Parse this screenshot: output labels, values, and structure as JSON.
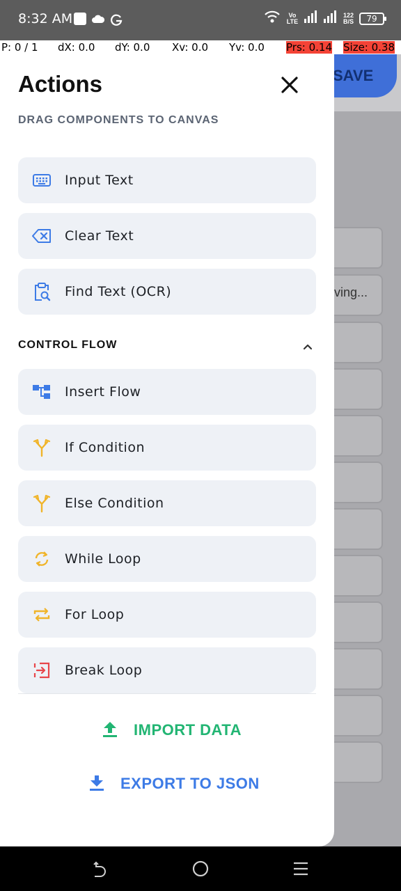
{
  "status_bar": {
    "time": "8:32 AM",
    "network_label": "Vo LTE",
    "speed_value": "122",
    "speed_unit": "B/S",
    "battery": "79"
  },
  "pointer_location": {
    "p": "P: 0 / 1",
    "dx": "dX: 0.0",
    "dy": "dY: 0.0",
    "xv": "Xv: 0.0",
    "yv": "Yv: 0.0",
    "prs": "Prs: 0.14",
    "size": "Size: 0.38"
  },
  "background_app": {
    "save_label": "SAVE",
    "partial_text": "ving..."
  },
  "drawer": {
    "title": "Actions",
    "subtitle": "DRAG COMPONENTS TO CANVAS",
    "text_items": [
      {
        "label": "Input Text",
        "icon": "keyboard-icon"
      },
      {
        "label": "Clear Text",
        "icon": "backspace-icon"
      },
      {
        "label": "Find Text (OCR)",
        "icon": "clipboard-search-icon"
      }
    ],
    "control_flow": {
      "header": "CONTROL FLOW",
      "expanded": true,
      "items": [
        {
          "label": "Insert Flow",
          "icon": "flow-tree-icon"
        },
        {
          "label": "If Condition",
          "icon": "fork-icon"
        },
        {
          "label": "Else Condition",
          "icon": "fork-icon"
        },
        {
          "label": "While Loop",
          "icon": "sync-icon"
        },
        {
          "label": "For Loop",
          "icon": "repeat-icon"
        },
        {
          "label": "Break Loop",
          "icon": "exit-icon"
        }
      ]
    },
    "import_label": "IMPORT DATA",
    "export_label": "EXPORT TO JSON"
  },
  "colors": {
    "accent_blue": "#3d7be6",
    "accent_green": "#22b573",
    "icon_amber": "#f0b429",
    "icon_red": "#e8454a",
    "item_bg": "#eef1f6"
  }
}
